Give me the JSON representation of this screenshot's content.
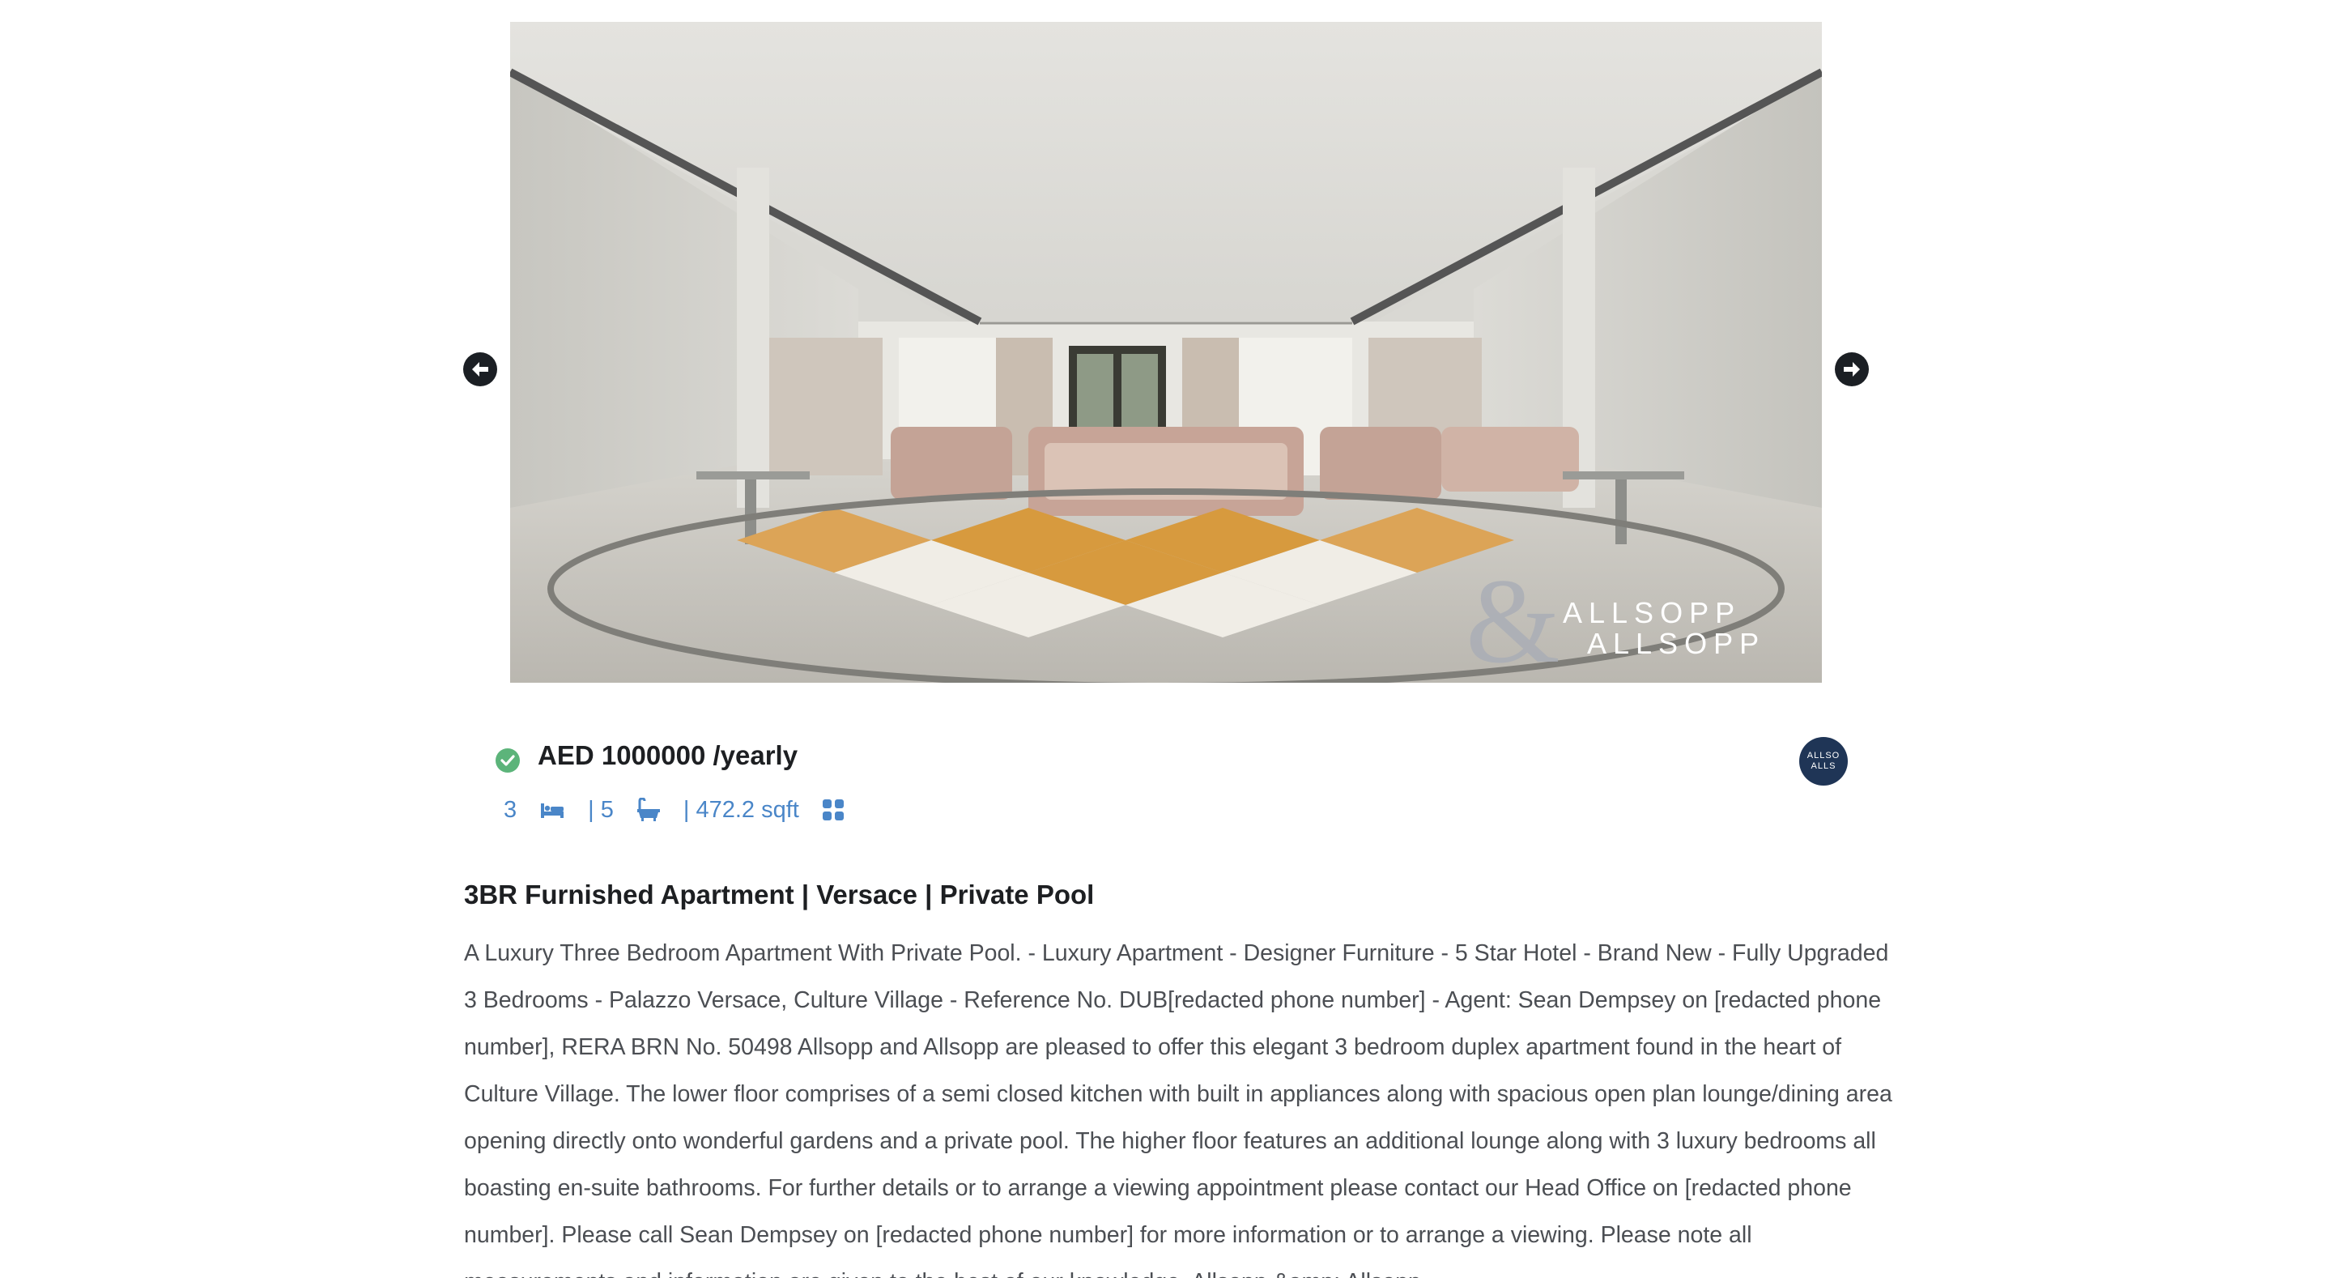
{
  "carousel": {
    "prev_icon": "arrow-left-circle-icon",
    "next_icon": "arrow-right-circle-icon",
    "watermark": {
      "line1": "ALLSOPP",
      "line2": "ALLSOPP"
    }
  },
  "listing": {
    "verified_icon": "check-circle-icon",
    "price": "AED 1000000 /yearly",
    "bedrooms": "3",
    "bedroom_icon": "bed-icon",
    "bathrooms": "| 5",
    "bathroom_icon": "bathtub-icon",
    "area": "| 472.2 sqft",
    "area_icon": "grid-icon",
    "accent_color": "#4a86c8",
    "verified_color": "#5cb47a",
    "agency_logo": {
      "line1": "ALLSO",
      "line2": "ALLS"
    },
    "title": "3BR Furnished Apartment | Versace | Private Pool",
    "description": "A Luxury Three Bedroom Apartment With Private Pool. - Luxury Apartment - Designer Furniture - 5 Star Hotel - Brand New - Fully Upgraded 3 Bedrooms - Palazzo Versace, Culture Village - Reference No. DUB[redacted phone number] - Agent: Sean Dempsey on [redacted phone number], RERA BRN No. 50498 Allsopp and Allsopp are pleased to offer this elegant 3 bedroom duplex apartment found in the heart of Culture Village. The lower floor comprises of a semi closed kitchen with built in appliances along with spacious open plan lounge/dining area opening directly onto wonderful gardens and a private pool. The higher floor features an additional lounge along with 3 luxury bedrooms all boasting en-suite bathrooms. For further details or to arrange a viewing appointment please contact our Head Office on [redacted phone number]. Please call Sean Dempsey on [redacted phone number] for more information or to arrange a viewing. Please note all measurements and information are given to the best of our knowledge. Allsopp &amp; Allsopp"
  }
}
